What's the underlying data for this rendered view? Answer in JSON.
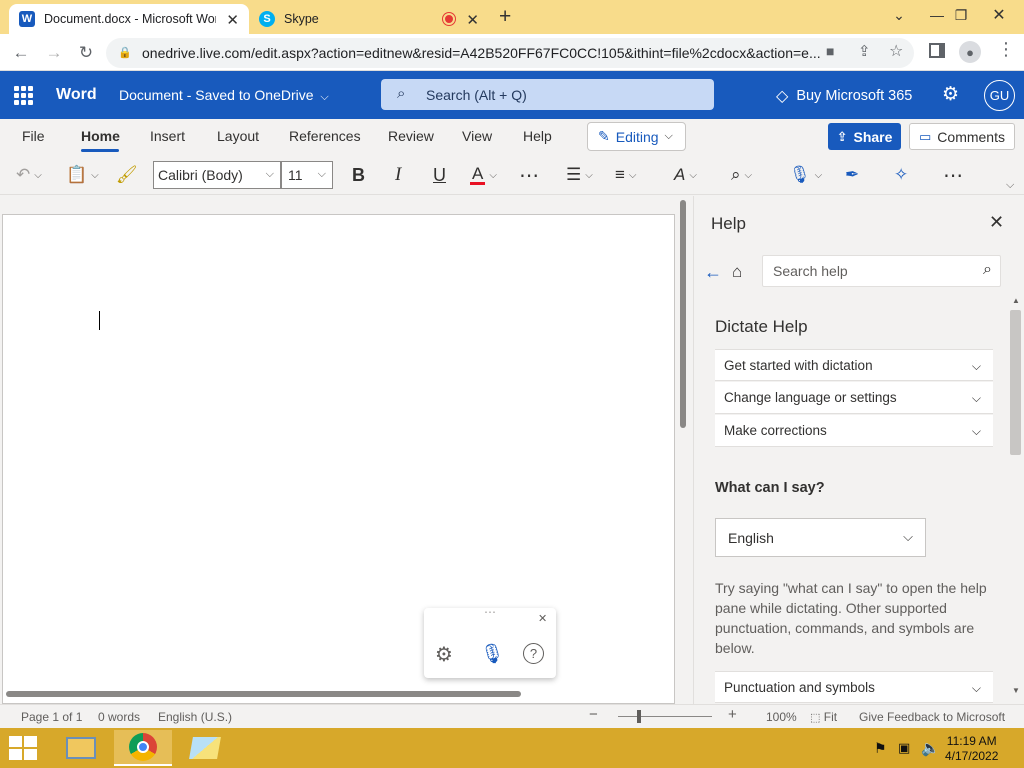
{
  "browser": {
    "tabs": [
      {
        "title": "Document.docx - Microsoft Word",
        "icon": "word-icon",
        "favicon_letter": "W"
      },
      {
        "title": "Skype",
        "icon": "skype-icon",
        "favicon_letter": "S"
      }
    ],
    "url": "onedrive.live.com/edit.aspx?action=editnew&resid=A42B520FF67FC0CC!105&ithint=file%2cdocx&action=e..."
  },
  "word": {
    "app_name": "Word",
    "doc_title": "Document - Saved to OneDrive",
    "search_placeholder": "Search (Alt + Q)",
    "buy_label": "Buy Microsoft 365",
    "avatar_initials": "GU",
    "ribbon_tabs": [
      "File",
      "Home",
      "Insert",
      "Layout",
      "References",
      "Review",
      "View",
      "Help"
    ],
    "active_tab": "Home",
    "editing_label": "Editing",
    "share_label": "Share",
    "comments_label": "Comments",
    "font_name": "Calibri (Body)",
    "font_size": "11",
    "bold": "B",
    "italic": "I",
    "underline": "U",
    "font_color_glyph": "A",
    "accent_color": "#185abd",
    "font_color": "#e81123"
  },
  "help": {
    "title": "Help",
    "search_placeholder": "Search help",
    "section_title": "Dictate Help",
    "accordion": [
      "Get started with dictation",
      "Change language or settings",
      "Make corrections"
    ],
    "what_can_i_say": "What can I say?",
    "language": "English",
    "description": "Try saying \"what can I say\" to open the help pane while dictating. Other supported punctuation, commands, and symbols are below.",
    "punctuation": "Punctuation and symbols"
  },
  "status": {
    "page": "Page 1 of 1",
    "words": "0 words",
    "language": "English (U.S.)",
    "zoom": "100%",
    "fit": "Fit",
    "feedback": "Give Feedback to Microsoft",
    "zoom_minus": "−",
    "zoom_plus": "+"
  },
  "taskbar": {
    "time": "11:19 AM",
    "date": "4/17/2022"
  }
}
